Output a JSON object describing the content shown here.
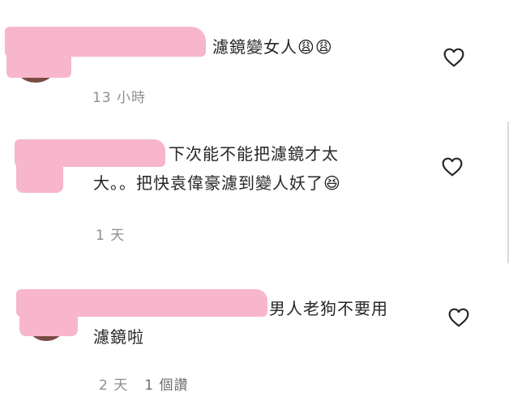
{
  "comments": [
    {
      "text_line1": "濾鏡變女人😩😩",
      "time": "13 小時",
      "reply": "",
      "like_icon": "heart-outline-icon"
    },
    {
      "text_line1": "下次能不能把濾鏡才太",
      "text_line2": "大。。把快袁偉豪濾到變人妖了😆",
      "time": "1 天",
      "reply": "",
      "like_icon": "heart-outline-icon"
    },
    {
      "text_line1": "男人老狗不要用",
      "text_line2": "濾鏡啦",
      "time": "2 天",
      "reply": "1 個讚",
      "like_icon": "heart-outline-icon"
    }
  ],
  "colors": {
    "redaction": "#f7b6cc",
    "text": "#262626",
    "meta": "#8e8e8e"
  }
}
